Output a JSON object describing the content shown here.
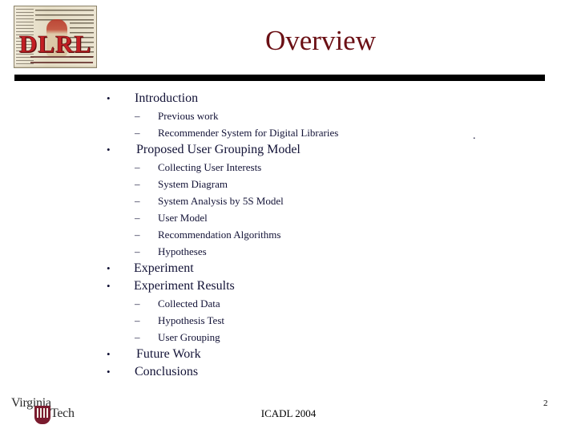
{
  "slide": {
    "title": "Overview",
    "page_number": "2",
    "title_color": "#6B1015",
    "body_text_color": "#121236",
    "rule_color": "#000000",
    "stray_mark": "."
  },
  "logo_dlrl": {
    "name": "dlrl-logo",
    "wordmark": "DLRL"
  },
  "logo_vt": {
    "name": "virginia-tech-logo",
    "line1": "Virginia",
    "line2": "Tech"
  },
  "footer": {
    "center_text": "ICADL 2004"
  },
  "outline": [
    {
      "level": 1,
      "text": "Introduction"
    },
    {
      "level": 2,
      "text": "Previous work"
    },
    {
      "level": 2,
      "text": "Recommender System for Digital Libraries"
    },
    {
      "level": 1,
      "text": "Proposed User Grouping Model"
    },
    {
      "level": 2,
      "text": "Collecting User Interests"
    },
    {
      "level": 2,
      "text": "System Diagram"
    },
    {
      "level": 2,
      "text": "System Analysis by 5S Model"
    },
    {
      "level": 2,
      "text": "User Model"
    },
    {
      "level": 2,
      "text": "Recommendation Algorithms"
    },
    {
      "level": 2,
      "text": "Hypotheses"
    },
    {
      "level": 1,
      "text": "Experiment"
    },
    {
      "level": 1,
      "text": "Experiment Results"
    },
    {
      "level": 2,
      "text": "Collected Data"
    },
    {
      "level": 2,
      "text": "Hypothesis Test"
    },
    {
      "level": 2,
      "text": "User Grouping"
    },
    {
      "level": 1,
      "text": "Future Work"
    },
    {
      "level": 1,
      "text": "Conclusions"
    }
  ],
  "glyphs": {
    "bullet_level1": "•",
    "bullet_level2": "–"
  }
}
